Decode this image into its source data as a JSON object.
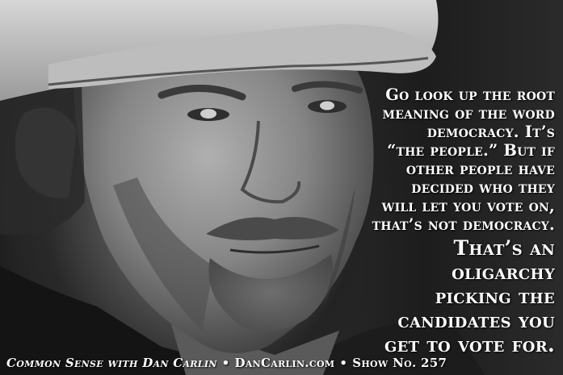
{
  "quote": {
    "line_1": "Go look up the root",
    "line_2": "meaning of the word",
    "line_3": "democracy. It’s",
    "line_4": "“the people.” But if",
    "line_5": "other people have",
    "line_6": "decided who they",
    "line_7": "will let you vote on,",
    "line_8": "that’s not democracy.",
    "line_9": "That’s an",
    "line_10": "oligarchy",
    "line_11": "picking the",
    "line_12": "candidates you",
    "line_13": "get to vote for."
  },
  "footer": {
    "show_name": "Common Sense with Dan Carlin",
    "separator": "•",
    "website": "DanCarlin.com",
    "episode": "Show No. 257"
  }
}
